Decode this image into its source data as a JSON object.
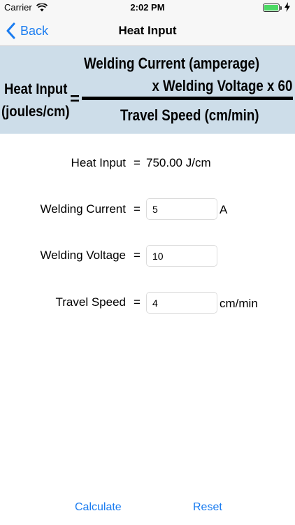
{
  "status_bar": {
    "carrier": "Carrier",
    "time": "2:02 PM"
  },
  "nav": {
    "back_label": "Back",
    "title": "Heat Input"
  },
  "formula": {
    "lhs_line1": "Heat Input",
    "lhs_line2": "(joules/cm)",
    "equals": "=",
    "numerator_line1": "Welding Current (amperage)",
    "numerator_line2": "x Welding Voltage x 60",
    "denominator": "Travel Speed (cm/min)"
  },
  "result": {
    "label": "Heat Input",
    "equals": "=",
    "value": "750.00 J/cm"
  },
  "fields": [
    {
      "label": "Welding Current",
      "equals": "=",
      "value": "5",
      "unit": "A"
    },
    {
      "label": "Welding Voltage",
      "equals": "=",
      "value": "10",
      "unit": ""
    },
    {
      "label": "Travel Speed",
      "equals": "=",
      "value": "4",
      "unit": "cm/min"
    }
  ],
  "buttons": {
    "calculate": "Calculate",
    "reset": "Reset"
  },
  "colors": {
    "accent": "#1a7cf0",
    "banner": "#cddde9",
    "battery": "#4cd964"
  }
}
